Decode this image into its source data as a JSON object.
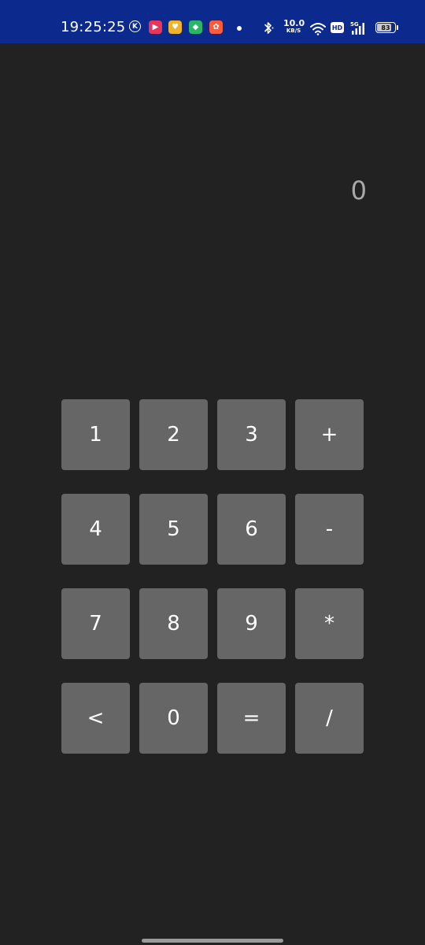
{
  "status_bar": {
    "time": "19:25:25",
    "net_speed_value": "10.0",
    "net_speed_unit": "KB/S",
    "hd_badge": "HD",
    "network_type": "5G",
    "battery_level": "83",
    "colors": {
      "background": "#0c2a8e"
    },
    "app_icons": [
      {
        "name": "k-app-icon",
        "glyph": "K",
        "color": "transparent"
      },
      {
        "name": "video-app-icon",
        "glyph": "▶",
        "color": "#e8345a"
      },
      {
        "name": "heart-app-icon",
        "glyph": "♥",
        "color": "#f0b429"
      },
      {
        "name": "shield-app-icon",
        "glyph": "◆",
        "color": "#2bb566"
      },
      {
        "name": "gift-app-icon",
        "glyph": "✿",
        "color": "#ff5a3c"
      }
    ]
  },
  "display": {
    "value": "0"
  },
  "keypad": {
    "keys": [
      {
        "label": "1",
        "name": "key-1"
      },
      {
        "label": "2",
        "name": "key-2"
      },
      {
        "label": "3",
        "name": "key-3"
      },
      {
        "label": "+",
        "name": "key-add"
      },
      {
        "label": "4",
        "name": "key-4"
      },
      {
        "label": "5",
        "name": "key-5"
      },
      {
        "label": "6",
        "name": "key-6"
      },
      {
        "label": "-",
        "name": "key-subtract"
      },
      {
        "label": "7",
        "name": "key-7"
      },
      {
        "label": "8",
        "name": "key-8"
      },
      {
        "label": "9",
        "name": "key-9"
      },
      {
        "label": "*",
        "name": "key-multiply"
      },
      {
        "label": "<",
        "name": "key-backspace"
      },
      {
        "label": "0",
        "name": "key-0"
      },
      {
        "label": "=",
        "name": "key-equals"
      },
      {
        "label": "/",
        "name": "key-divide"
      }
    ]
  },
  "colors": {
    "background": "#222222",
    "key_background": "#666666",
    "key_text": "#ffffff",
    "display_text": "#a9a9a9"
  }
}
